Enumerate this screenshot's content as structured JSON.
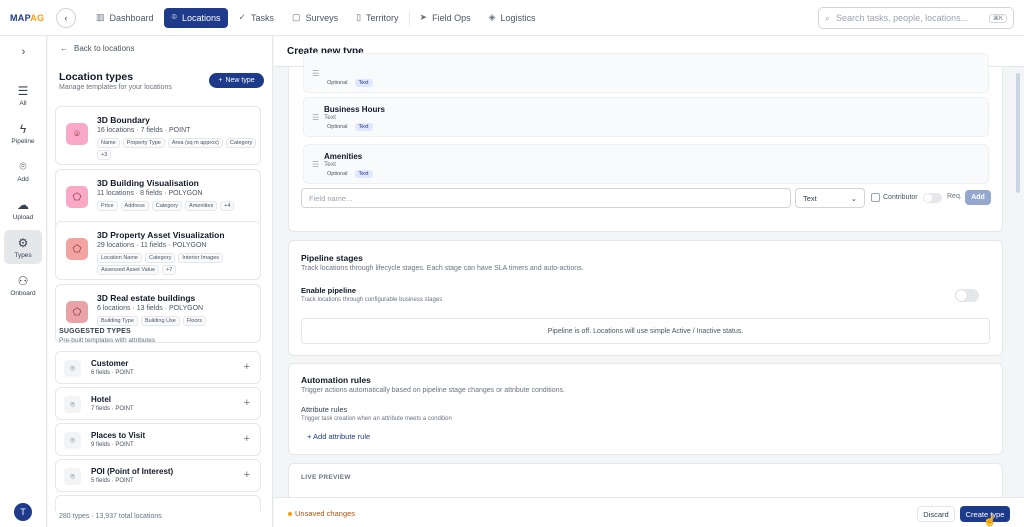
{
  "app": {
    "logo_main": "MAP",
    "logo_accent": "AG"
  },
  "nav": {
    "items": [
      {
        "label": "Dashboard",
        "icon": "bar-chart-icon"
      },
      {
        "label": "Locations",
        "icon": "map-pin-icon",
        "active": true
      },
      {
        "label": "Tasks",
        "icon": "tasks-icon"
      },
      {
        "label": "Surveys",
        "icon": "clipboard-icon"
      },
      {
        "label": "Territory",
        "icon": "map-icon"
      },
      {
        "label": "Field Ops",
        "icon": "send-icon"
      },
      {
        "label": "Logistics",
        "icon": "box-icon"
      }
    ]
  },
  "search": {
    "placeholder": "Search tasks, people, locations...",
    "shortcut": "⌘K"
  },
  "rail": {
    "items": [
      {
        "label": "All",
        "icon": "list-icon"
      },
      {
        "label": "Pipeline",
        "icon": "pipeline-icon"
      },
      {
        "label": "Add",
        "icon": "map-pin-icon"
      },
      {
        "label": "Upload",
        "icon": "upload-icon"
      },
      {
        "label": "Types",
        "icon": "gear-icon",
        "active": true
      },
      {
        "label": "Onboard",
        "icon": "user-plus-icon"
      }
    ],
    "avatar_initial": "T"
  },
  "sidebar": {
    "back_label": "Back to locations",
    "title": "Location types",
    "subtitle": "Manage templates for your locations",
    "new_type_label": "New type",
    "types": [
      {
        "name": "3D Boundary",
        "locations": "16 locations",
        "fields": "7 fields",
        "geometry": "POINT",
        "color": "#f9a8c6",
        "icon": "map-pin-icon",
        "tags": [
          "Name",
          "Property Type",
          "Area (sq m approx)",
          "Category",
          "+3"
        ]
      },
      {
        "name": "3D Building Visualisation",
        "locations": "11 locations",
        "fields": "8 fields",
        "geometry": "POLYGON",
        "color": "#f9a8c6",
        "icon": "polygon-icon",
        "tags": [
          "Price",
          "Address",
          "Category",
          "Amenities",
          "+4"
        ]
      },
      {
        "name": "3D Property Asset Visualization",
        "locations": "29 locations",
        "fields": "11 fields",
        "geometry": "POLYGON",
        "color": "#f4a3a3",
        "icon": "polygon-icon",
        "tags": [
          "Location Name",
          "Category",
          "Interior Images",
          "Assessed Asset Value",
          "+7"
        ]
      },
      {
        "name": "3D Real estate buildings",
        "locations": "6 locations",
        "fields": "13 fields",
        "geometry": "POLYGON",
        "color": "#e8a2a8",
        "icon": "polygon-icon",
        "tags": [
          "Building Type",
          "Building Use",
          "Floors"
        ]
      }
    ],
    "suggested_title": "SUGGESTED TYPES",
    "suggested_subtitle": "Pre-built templates with attributes",
    "suggested": [
      {
        "name": "Customer",
        "meta": "6 fields · POINT"
      },
      {
        "name": "Hotel",
        "meta": "7 fields · POINT"
      },
      {
        "name": "Places to Visit",
        "meta": "9 fields · POINT"
      },
      {
        "name": "POI (Point of Interest)",
        "meta": "5 fields · POINT"
      }
    ],
    "footer": "280 types · 13,937 total locations"
  },
  "main": {
    "title": "Create new type",
    "fields": [
      {
        "name": "",
        "type": "",
        "required": "Optional",
        "badge": "Text"
      },
      {
        "name": "Business Hours",
        "type": "Text",
        "required": "Optional",
        "badge": "Text"
      },
      {
        "name": "Amenities",
        "type": "Text",
        "required": "Optional",
        "badge": "Text"
      }
    ],
    "new_field": {
      "placeholder": "Field name...",
      "type_value": "Text",
      "contributor_label": "Contributor",
      "req_label": "Req.",
      "add_label": "Add"
    },
    "pipeline": {
      "title": "Pipeline stages",
      "subtitle": "Track locations through lifecycle stages. Each stage can have SLA timers and auto-actions.",
      "enable_title": "Enable pipeline",
      "enable_subtitle": "Track locations through configurable business stages",
      "off_message": "Pipeline is off. Locations will use simple Active / Inactive status."
    },
    "automation": {
      "title": "Automation rules",
      "subtitle": "Trigger actions automatically based on pipeline stage changes or attribute conditions.",
      "attr_title": "Attribute rules",
      "attr_subtitle": "Trigger task creation when an attribute meets a condition",
      "add_rule_label": "+ Add attribute rule"
    },
    "live_preview_label": "LIVE PREVIEW",
    "footer": {
      "unsaved_label": "Unsaved changes",
      "discard_label": "Discard",
      "create_label": "Create type"
    }
  }
}
